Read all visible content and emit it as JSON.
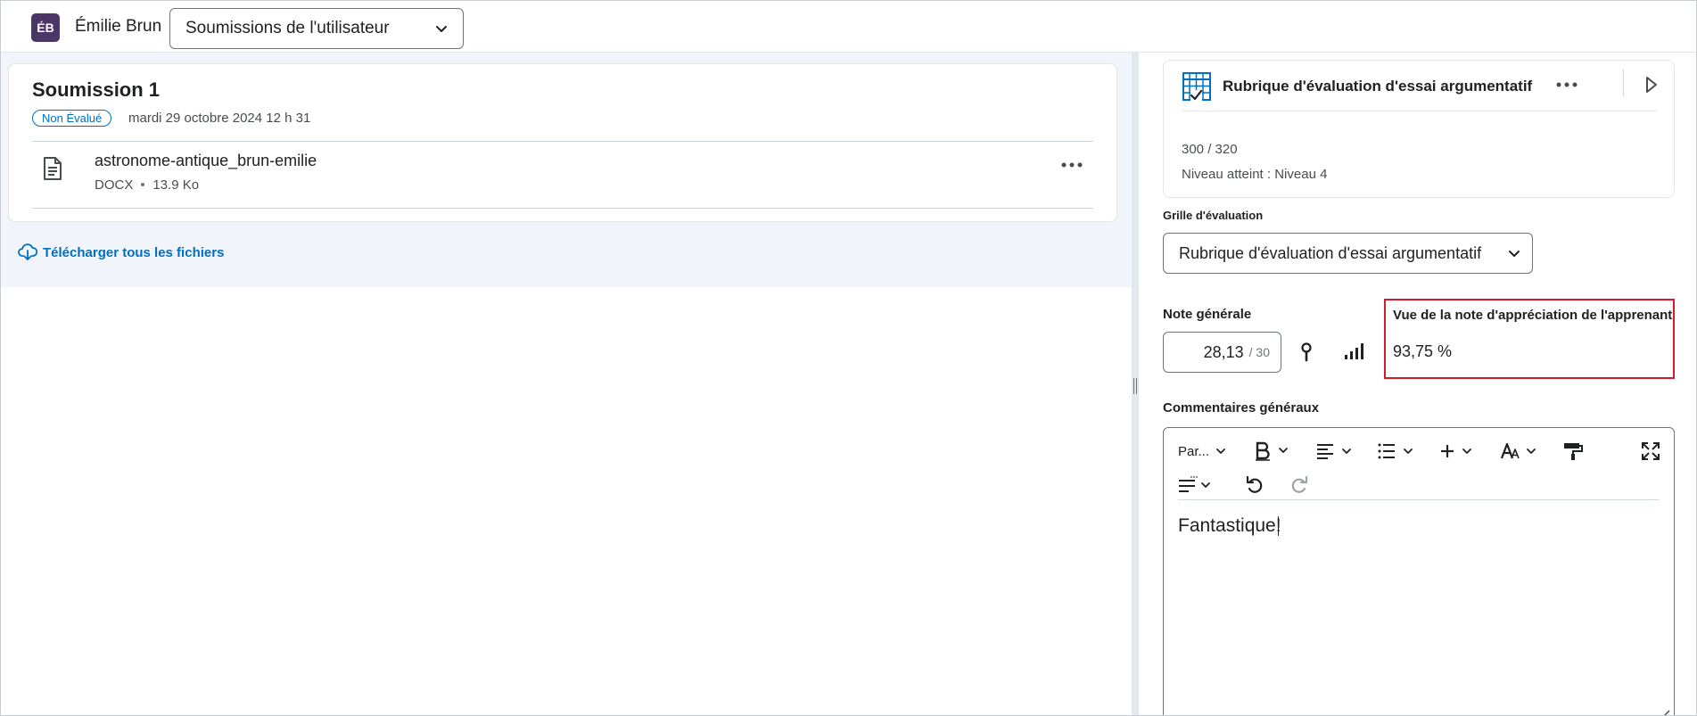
{
  "header": {
    "avatar_initials": "ÉB",
    "user_name": "Émilie Brun",
    "submissions_select": "Soumissions de l'utilisateur"
  },
  "submission": {
    "title": "Soumission 1",
    "status_badge": "Non Évalué",
    "date": "mardi 29 octobre 2024 12 h 31",
    "file": {
      "name": "astronome-antique_brun-emilie",
      "type": "DOCX",
      "size": "13.9 Ko"
    },
    "download_all": "Télécharger tous les fichiers"
  },
  "rubric": {
    "title": "Rubrique d'évaluation d'essai argumentatif",
    "score": "300 / 320",
    "level": "Niveau atteint : Niveau 4"
  },
  "grid": {
    "label": "Grille d'évaluation",
    "selected": "Rubrique d'évaluation d'essai argumentatif"
  },
  "grade": {
    "label": "Note générale",
    "value": "28,13",
    "out_of": "/ 30"
  },
  "learner_view": {
    "label": "Vue de la note d'appréciation de l'apprenant",
    "value": "93,75 %"
  },
  "comments": {
    "label": "Commentaires généraux",
    "paragraph_select": "Par...",
    "text": "Fantastique!"
  },
  "colors": {
    "avatar": "#4b3667",
    "link": "#006fbf",
    "highlight_border": "#d11a2a",
    "left_background": "#f1f5fb"
  }
}
